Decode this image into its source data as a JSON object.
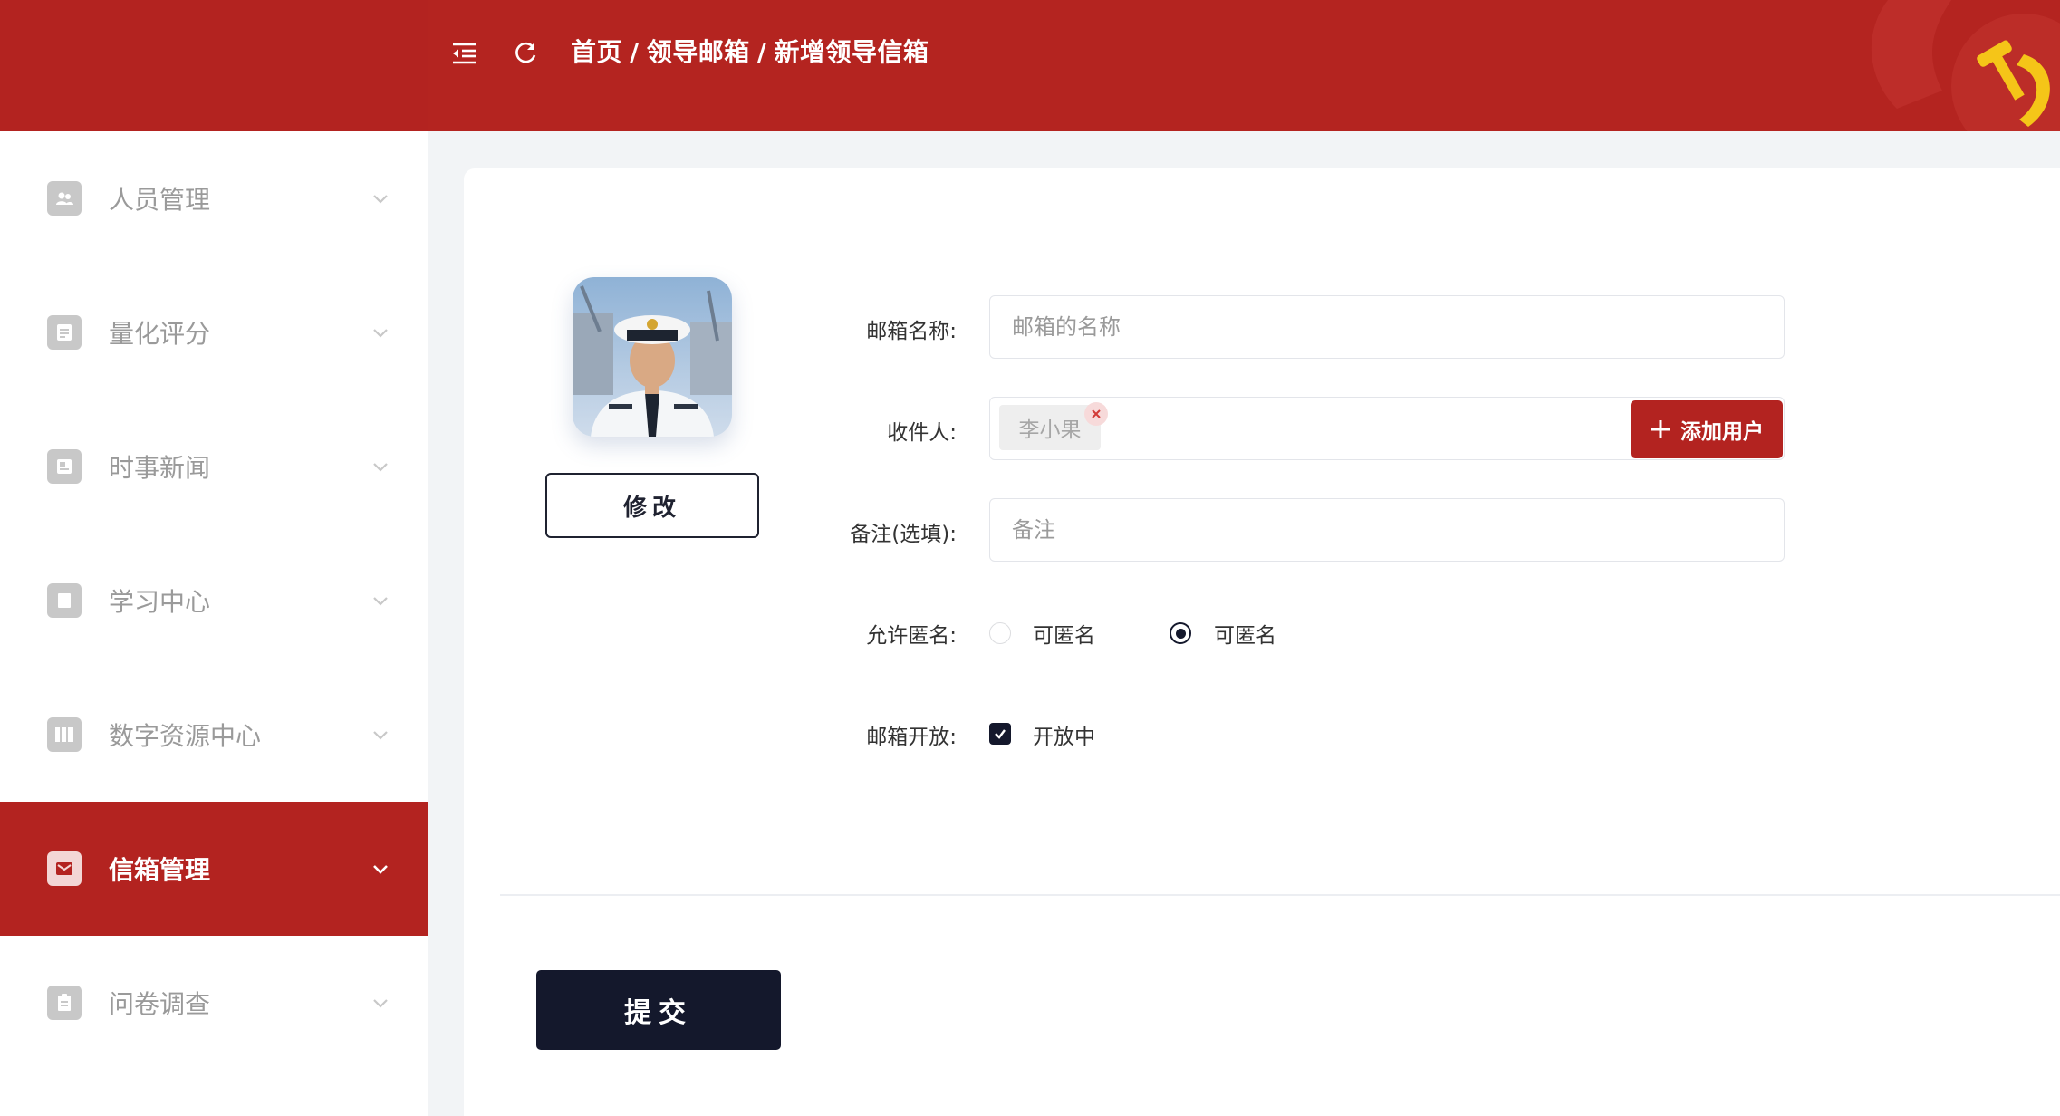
{
  "header": {
    "breadcrumb": [
      "首页",
      "领导邮箱",
      "新增领导信箱"
    ],
    "separator": "/",
    "accent_color": "#b32320"
  },
  "sidebar": {
    "items": [
      {
        "label": "人员管理",
        "icon": "users-icon",
        "active": false
      },
      {
        "label": "量化评分",
        "icon": "score-icon",
        "active": false
      },
      {
        "label": "时事新闻",
        "icon": "news-icon",
        "active": false
      },
      {
        "label": "学习中心",
        "icon": "book-icon",
        "active": false
      },
      {
        "label": "数字资源中心",
        "icon": "resource-icon",
        "active": false
      },
      {
        "label": "信箱管理",
        "icon": "mail-icon",
        "active": true
      },
      {
        "label": "问卷调查",
        "icon": "survey-icon",
        "active": false
      }
    ]
  },
  "avatar": {
    "edit_label": "修改"
  },
  "form": {
    "mailbox_name": {
      "label": "邮箱名称:",
      "value": "",
      "placeholder": "邮箱的名称"
    },
    "recipient": {
      "label": "收件人:",
      "tags": [
        "李小果"
      ],
      "add_button": "添加用户"
    },
    "remark": {
      "label": "备注(选填):",
      "value": "",
      "placeholder": "备注"
    },
    "anonymous": {
      "label": "允许匿名:",
      "options": [
        {
          "label": "可匿名",
          "checked": false
        },
        {
          "label": "可匿名",
          "checked": true
        }
      ]
    },
    "open": {
      "label": "邮箱开放:",
      "checkbox_label": "开放中",
      "checked": true
    }
  },
  "submit_label": "提交"
}
